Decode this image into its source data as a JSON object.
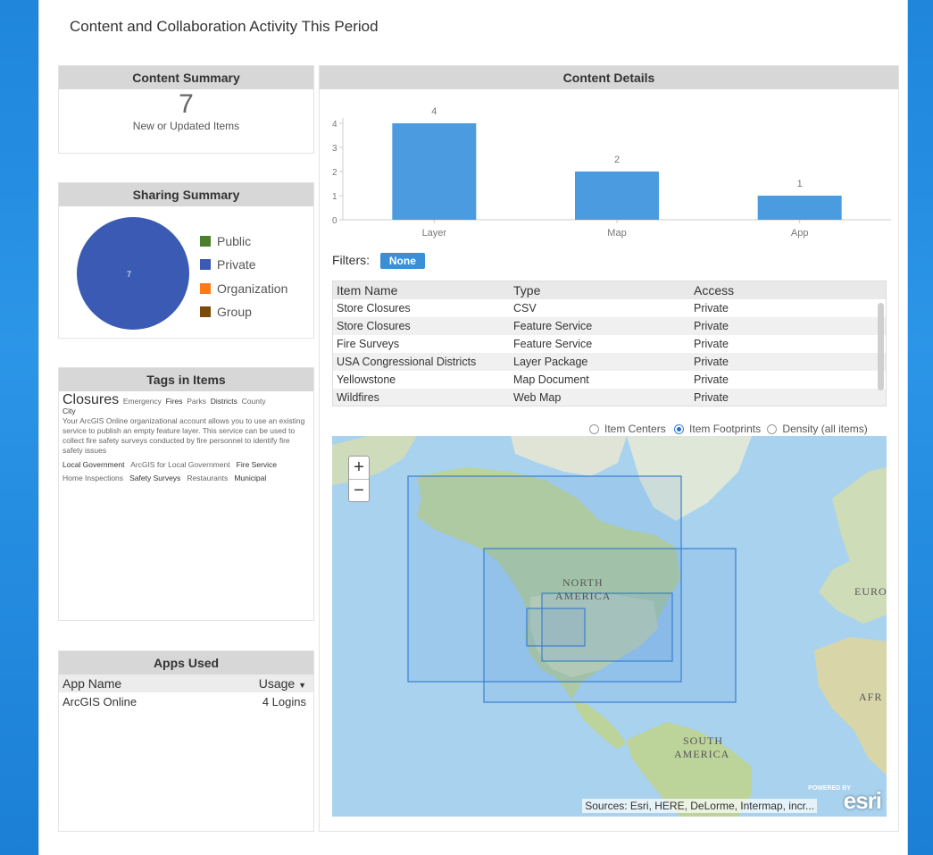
{
  "page": {
    "title": "Content and Collaboration Activity This Period"
  },
  "content_summary": {
    "header": "Content Summary",
    "count": "7",
    "label": "New or Updated Items"
  },
  "sharing_summary": {
    "header": "Sharing Summary",
    "pie_label": "7",
    "legend": [
      {
        "label": "Public",
        "color": "#4c7f2d"
      },
      {
        "label": "Private",
        "color": "#3a5ab4"
      },
      {
        "label": "Organization",
        "color": "#ff7a1a"
      },
      {
        "label": "Group",
        "color": "#7a4a0a"
      }
    ]
  },
  "tags": {
    "header": "Tags in Items",
    "line1": {
      "big": "Closures",
      "emergency": "Emergency",
      "fires": "Fires",
      "parks": "Parks",
      "districts": "Districts",
      "county": "County"
    },
    "city": "City",
    "description": "Your ArcGIS Online organizational account allows you to use an existing service to publish an empty feature layer.  This service can be used to collect fire safety surveys conducted by fire personnel to identify fire safety issues",
    "line3": {
      "local_gov": "Local Government",
      "arcgis_local": "ArcGIS for Local Government",
      "fire_service": "Fire Service"
    },
    "line4": {
      "home": "Home Inspections",
      "safety": "Safety Surveys",
      "restaurants": "Restaurants",
      "municipal": "Municipal"
    }
  },
  "apps_used": {
    "header": "Apps Used",
    "col_name": "App Name",
    "col_usage": "Usage",
    "sort_icon": "caret-down",
    "rows": [
      {
        "name": "ArcGIS Online",
        "usage": "4 Logins"
      }
    ]
  },
  "content_details": {
    "header": "Content Details",
    "filters_label": "Filters:",
    "filter_value": "None",
    "table": {
      "columns": [
        "Item Name",
        "Type",
        "Access"
      ],
      "rows": [
        {
          "name": "Store Closures",
          "type": "CSV",
          "access": "Private"
        },
        {
          "name": "Store Closures",
          "type": "Feature Service",
          "access": "Private"
        },
        {
          "name": "Fire Surveys",
          "type": "Feature Service",
          "access": "Private"
        },
        {
          "name": "USA Congressional Districts",
          "type": "Layer Package",
          "access": "Private"
        },
        {
          "name": "Yellowstone",
          "type": "Map Document",
          "access": "Private"
        },
        {
          "name": "Wildfires",
          "type": "Web Map",
          "access": "Private"
        }
      ]
    }
  },
  "map": {
    "options": [
      "Item Centers",
      "Item Footprints",
      "Density (all items)"
    ],
    "selected_option": "Item Footprints",
    "zoom_in": "+",
    "zoom_out": "−",
    "labels": {
      "north_america_1": "NORTH",
      "north_america_2": "AMERICA",
      "south_america_1": "SOUTH",
      "south_america_2": "AMERICA",
      "europe": "EURO",
      "africa": "AFR"
    },
    "attribution": "Sources: Esri, HERE, DeLorme, Intermap, incr...",
    "logo_small": "POWERED BY",
    "logo": "esri"
  },
  "chart_data": {
    "type": "bar",
    "categories": [
      "Layer",
      "Map",
      "App"
    ],
    "values": [
      4,
      2,
      1
    ],
    "y_ticks": [
      "0",
      "1",
      "2",
      "3",
      "4"
    ],
    "ylim": [
      0,
      4
    ],
    "bar_color": "#4a9be0"
  }
}
